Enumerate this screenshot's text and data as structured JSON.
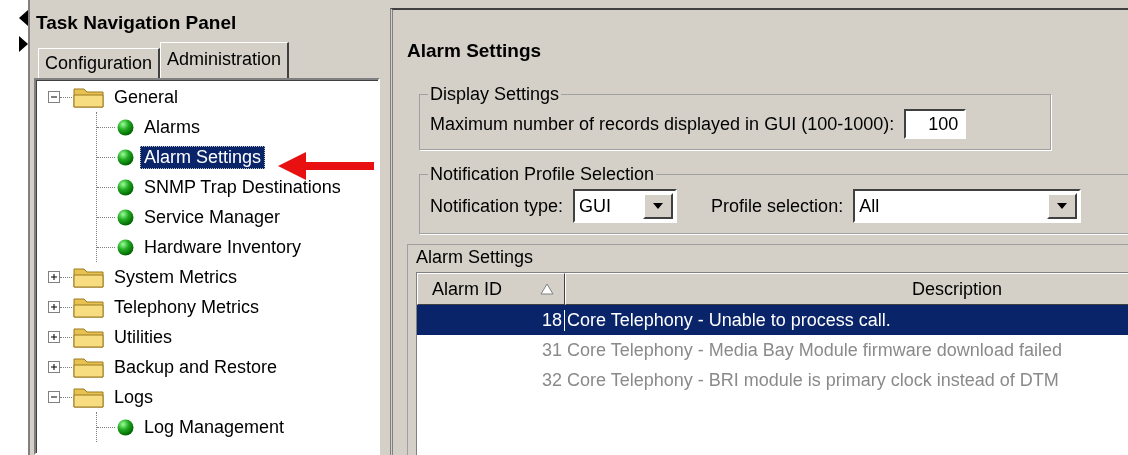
{
  "panel": {
    "title": "Task Navigation Panel",
    "tabs": [
      {
        "label": "Configuration",
        "selected": false
      },
      {
        "label": "Administration",
        "selected": true
      }
    ],
    "tree": [
      {
        "label": "General",
        "kind": "folder",
        "expanded": true,
        "selected": false,
        "children": [
          {
            "label": "Alarms",
            "kind": "leaf",
            "selected": false
          },
          {
            "label": "Alarm Settings",
            "kind": "leaf",
            "selected": true
          },
          {
            "label": "SNMP Trap Destinations",
            "kind": "leaf",
            "selected": false
          },
          {
            "label": "Service Manager",
            "kind": "leaf",
            "selected": false
          },
          {
            "label": "Hardware Inventory",
            "kind": "leaf",
            "selected": false
          }
        ]
      },
      {
        "label": "System Metrics",
        "kind": "folder",
        "expanded": false,
        "selected": false
      },
      {
        "label": "Telephony Metrics",
        "kind": "folder",
        "expanded": false,
        "selected": false
      },
      {
        "label": "Utilities",
        "kind": "folder",
        "expanded": false,
        "selected": false
      },
      {
        "label": "Backup and Restore",
        "kind": "folder",
        "expanded": false,
        "selected": false
      },
      {
        "label": "Logs",
        "kind": "folder",
        "expanded": true,
        "selected": false,
        "children": [
          {
            "label": "Log Management",
            "kind": "leaf",
            "selected": false
          }
        ]
      }
    ]
  },
  "content": {
    "title": "Alarm Settings",
    "display_settings": {
      "legend": "Display Settings",
      "label": "Maximum number of records displayed in GUI (100-1000):",
      "value": "100"
    },
    "notification": {
      "legend": "Notification Profile Selection",
      "type_label": "Notification type:",
      "type_value": "GUI",
      "profile_label": "Profile selection:",
      "profile_value": "All"
    },
    "table": {
      "title": "Alarm Settings",
      "columns": [
        {
          "label": "Alarm ID",
          "sorted": true
        },
        {
          "label": "Description",
          "sorted": false
        }
      ],
      "rows": [
        {
          "id": "18",
          "description": "Core Telephony - Unable to process call.",
          "selected": true,
          "disabled": false
        },
        {
          "id": "31",
          "description": "Core Telephony - Media Bay Module firmware download failed",
          "selected": false,
          "disabled": true
        },
        {
          "id": "32",
          "description": "Core Telephony - BRI module is primary clock instead of DTM",
          "selected": false,
          "disabled": true
        }
      ]
    }
  }
}
